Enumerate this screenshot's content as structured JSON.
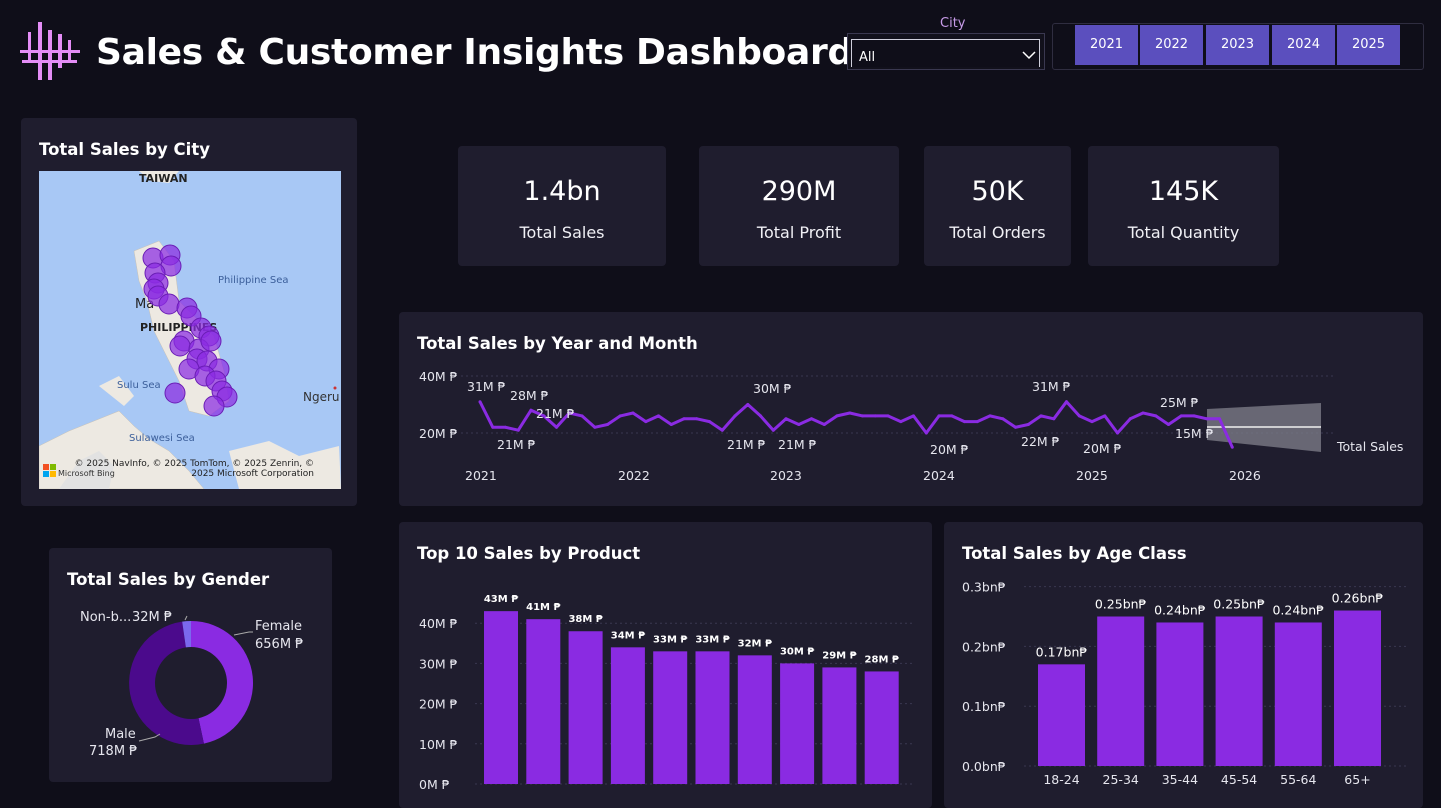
{
  "header": {
    "title": "Sales & Customer Insights Dashboard",
    "logo_icon": "bars-logo-icon"
  },
  "filters": {
    "city_label": "City",
    "city_value": "All",
    "years": [
      "2021",
      "2022",
      "2023",
      "2024",
      "2025"
    ]
  },
  "colors": {
    "background": "#0f0e19",
    "card": "#1f1d2e",
    "accent": "#8a2be2",
    "slicer": "#5b4fbe",
    "male": "#4b0a8c",
    "female": "#8a2be2",
    "nonbinary": "#7b68ee"
  },
  "kpis": [
    {
      "value": "1.4bn",
      "label": "Total Sales"
    },
    {
      "value": "290M",
      "label": "Total Profit"
    },
    {
      "value": "50K",
      "label": "Total Orders"
    },
    {
      "value": "145K",
      "label": "Total Quantity"
    }
  ],
  "map": {
    "title": "Total Sales by City",
    "place_labels": [
      "TAIWAN",
      "Philippine Sea",
      "Ma",
      "PHILIPPINES",
      "Sulu Sea",
      "Sulawesi Sea",
      "Ngeru"
    ],
    "attribution": "© 2025 NavInfo, © 2025 TomTom, © 2025 Zenrin, © 2025 Microsoft Corporation",
    "bing_label": "Microsoft Bing"
  },
  "line_chart": {
    "title": "Total Sales by Year and Month",
    "y_ticks": [
      "40M ₱",
      "20M ₱"
    ],
    "x_ticks": [
      "2021",
      "2022",
      "2023",
      "2024",
      "2025",
      "2026"
    ],
    "series_label": "Total Sales",
    "annotations": [
      "31M ₱",
      "28M ₱",
      "21M ₱",
      "21M ₱",
      "30M ₱",
      "21M ₱",
      "21M ₱",
      "20M ₱",
      "31M ₱",
      "22M ₱",
      "20M ₱",
      "25M ₱",
      "15M ₱"
    ]
  },
  "gender": {
    "title": "Total Sales by Gender",
    "labels": [
      {
        "name": "Female",
        "value": "656M ₱"
      },
      {
        "name": "Male",
        "value": "718M ₱"
      },
      {
        "name": "Non-b...",
        "value": "32M ₱"
      }
    ]
  },
  "products": {
    "title": "Top 10 Sales by Product",
    "y_ticks": [
      "40M ₱",
      "30M ₱",
      "20M ₱",
      "10M ₱",
      "0M ₱"
    ]
  },
  "age": {
    "title": "Total Sales by Age Class",
    "y_ticks": [
      "0.3bn₱",
      "0.2bn₱",
      "0.1bn₱",
      "0.0bn₱"
    ]
  },
  "chart_data": [
    {
      "type": "line",
      "title": "Total Sales by Year and Month",
      "x_range": [
        "2021-01",
        "2025-12"
      ],
      "forecast_to": "2026-06",
      "ylim": [
        10,
        40
      ],
      "units": "M ₱",
      "values": [
        31,
        22,
        22,
        21,
        28,
        26,
        22,
        27,
        26,
        22,
        23,
        26,
        27,
        24,
        26,
        23,
        25,
        25,
        24,
        21,
        26,
        30,
        26,
        21,
        25,
        23,
        25,
        23,
        26,
        27,
        26,
        26,
        26,
        24,
        26,
        20,
        26,
        26,
        24,
        24,
        26,
        25,
        22,
        23,
        26,
        25,
        31,
        26,
        24,
        26,
        20,
        25,
        27,
        26,
        23,
        26,
        26,
        25,
        25,
        15
      ],
      "x_ticks": [
        "2021",
        "2022",
        "2023",
        "2024",
        "2025",
        "2026"
      ]
    },
    {
      "type": "pie",
      "title": "Total Sales by Gender",
      "categories": [
        "Female",
        "Male",
        "Non-b..."
      ],
      "values": [
        656,
        718,
        32
      ],
      "units": "M ₱"
    },
    {
      "type": "bar",
      "title": "Top 10 Sales by Product",
      "values": [
        43,
        41,
        38,
        34,
        33,
        33,
        32,
        30,
        29,
        28
      ],
      "labels": [
        "43M ₱",
        "41M ₱",
        "38M ₱",
        "34M ₱",
        "33M ₱",
        "33M ₱",
        "32M ₱",
        "30M ₱",
        "29M ₱",
        "28M ₱"
      ],
      "ylim": [
        0,
        45
      ],
      "units": "M ₱"
    },
    {
      "type": "bar",
      "title": "Total Sales by Age Class",
      "categories": [
        "18-24",
        "25-34",
        "35-44",
        "45-54",
        "55-64",
        "65+"
      ],
      "values": [
        0.17,
        0.25,
        0.24,
        0.25,
        0.24,
        0.26
      ],
      "labels": [
        "0.17bn₱",
        "0.25bn₱",
        "0.24bn₱",
        "0.25bn₱",
        "0.24bn₱",
        "0.26bn₱"
      ],
      "ylim": [
        0,
        0.3
      ],
      "units": "bn₱"
    }
  ]
}
